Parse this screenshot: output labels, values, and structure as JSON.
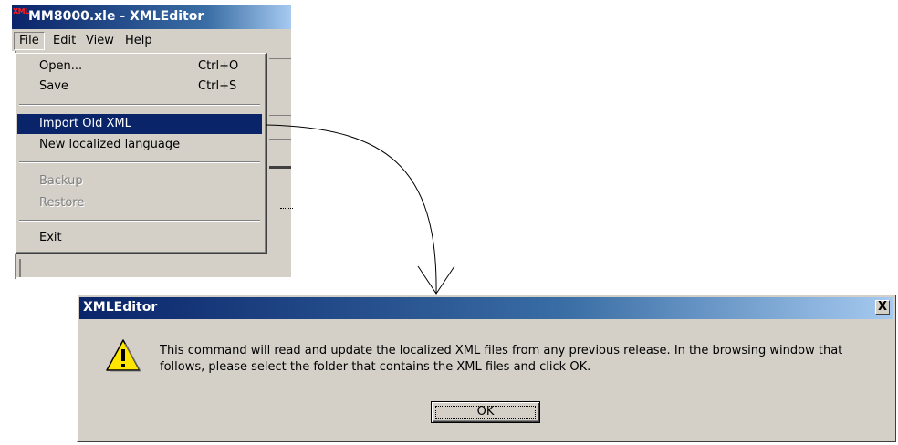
{
  "editor": {
    "icon_text": "XML",
    "title": "MM8000.xle - XMLEditor"
  },
  "menubar": {
    "items": [
      {
        "label": "File"
      },
      {
        "label": "Edit"
      },
      {
        "label": "View"
      },
      {
        "label": "Help"
      }
    ]
  },
  "file_menu": {
    "open": {
      "label": "Open...",
      "shortcut": "Ctrl+O"
    },
    "save": {
      "label": "Save",
      "shortcut": "Ctrl+S"
    },
    "import_old_xml": {
      "label": "Import Old XML",
      "highlighted": true
    },
    "new_localized_language": {
      "label": "New localized language"
    },
    "backup": {
      "label": "Backup",
      "enabled": false
    },
    "restore": {
      "label": "Restore",
      "enabled": false
    },
    "exit": {
      "label": "Exit"
    }
  },
  "dialog": {
    "title": "XMLEditor",
    "close_label": "X",
    "icon": "warning-icon",
    "message": "This command will read and update the localized XML files from any previous release. In the browsing window that follows, please select the folder that contains the XML files and click OK.",
    "ok_label": "OK"
  },
  "colors": {
    "titlebar": "#0a246a",
    "highlight": "#0a246a",
    "face": "#d4d0c8",
    "warning_yellow": "#ffe600"
  }
}
